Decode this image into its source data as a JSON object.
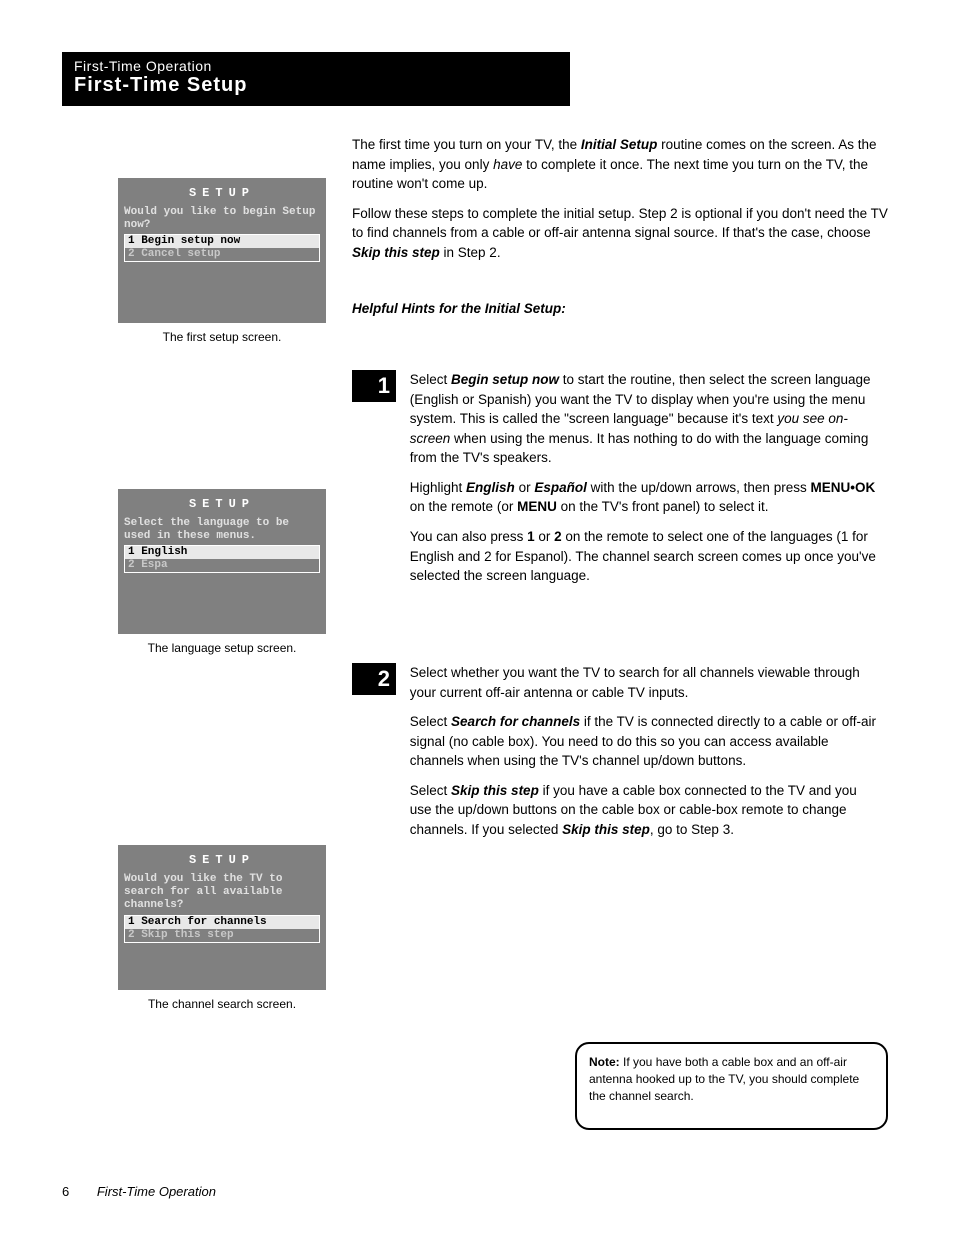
{
  "header": {
    "kicker": "First-Time Operation",
    "title": "First-Time Setup"
  },
  "intro": {
    "p1a": "The first time you turn on your TV, the ",
    "p1b": "Initial Setup",
    "p1c": " routine comes on the screen. As the name implies, you only ",
    "p1d": "have",
    "p1e": " to complete it once. The next time you turn on the TV, the routine won't come up.",
    "p2a": "Follow these steps to complete the initial setup. Step 2 is optional if you don't need the TV to find channels from a cable or off-air antenna signal source. If that's the case, choose ",
    "p2b": "Skip this step",
    "p2c": " in Step 2."
  },
  "helpful_heading": "Helpful Hints for the Initial Setup:",
  "screens": {
    "title": "SETUP",
    "s1": {
      "prompt": "Would you like to begin Setup now?",
      "opt1": "1 Begin setup now",
      "opt2": "2 Cancel setup"
    },
    "s2": {
      "prompt": "Select the language to be used in these menus.",
      "opt1": "1 English",
      "opt2": "2 Espa"
    },
    "s3": {
      "prompt": "Would you like the TV to search for all available channels?",
      "opt1": "1 Search for channels",
      "opt2": "2 Skip this step"
    }
  },
  "captions": {
    "c1": "The first setup screen.",
    "c2": "The language setup screen.",
    "c3": "The channel search screen."
  },
  "steps": {
    "s1": {
      "num": "1",
      "p1a": "Select ",
      "p1b": "Begin setup now",
      "p1c": " to start the routine, then select the screen language (English or Spanish) you want the TV to display when you're using the menu system. This is called the \"screen language\" because it's text ",
      "p1d": "you see on-screen",
      "p1e": " when using the menus. It has nothing to do with the language coming from the TV's speakers.",
      "p2a": "Highlight ",
      "p2b": "English",
      "p2c": " or ",
      "p2d": "Español",
      "p2e": " with the up/down arrows, then press ",
      "p2f": "MENU•OK",
      "p2g": " on the remote (or ",
      "p2h": "MENU",
      "p2i": " on the TV's front panel) to select it.",
      "p3a": "You can also press ",
      "p3b": "1",
      "p3c": " or ",
      "p3d": "2",
      "p3e": " on the remote to select one of the languages (1 for English and 2 for Espanol). The channel search screen comes up once you've selected the screen language."
    },
    "s2": {
      "num": "2",
      "p1": "Select whether you want the TV to search for all channels viewable through your current off-air antenna or cable TV inputs.",
      "p2a": "Select ",
      "p2b": "Search for channels",
      "p2c": " if the TV is connected directly to a cable or off-air signal (no cable box). You need to do this so you can access available channels when using the TV's channel up/down buttons.",
      "p3a": "Select ",
      "p3b": "Skip this step",
      "p3c": " if you have a cable box connected to the TV and you use the up/down buttons on the cable box or cable-box remote to change channels. If you selected ",
      "p3d": "Skip this step",
      "p3e": ", go to Step 3."
    }
  },
  "note": {
    "label": "Note:",
    "text": " If you have both a cable box and an off-air antenna hooked up to the TV, you should complete the channel search."
  },
  "footer": {
    "page": "6",
    "title": "First-Time Operation"
  }
}
